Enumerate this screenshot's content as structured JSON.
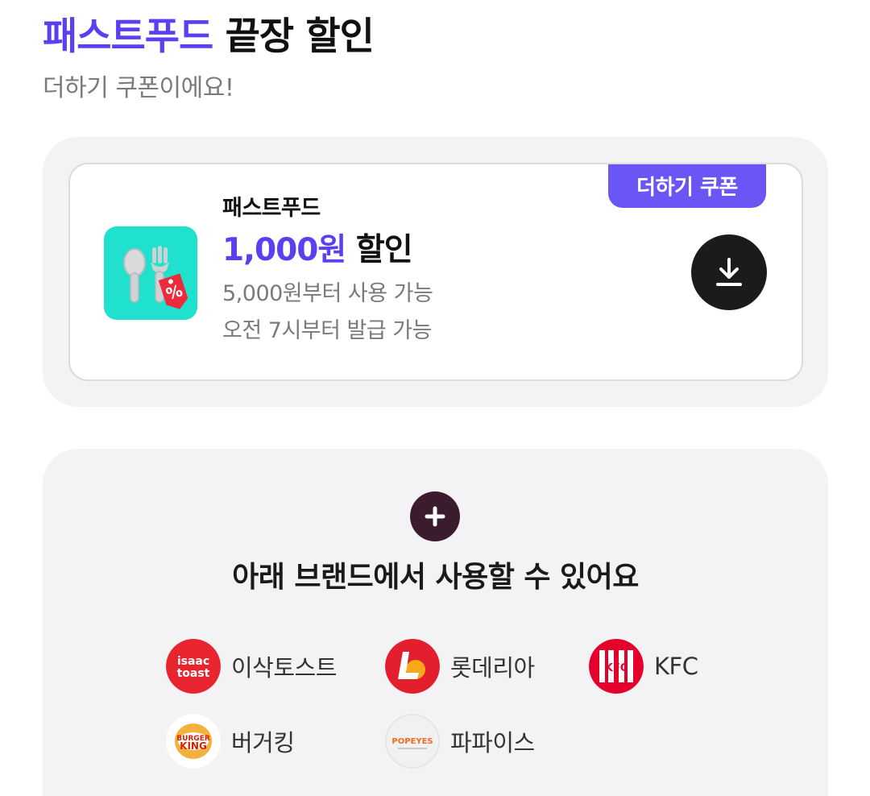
{
  "header": {
    "title_accent": "패스트푸드",
    "title_rest": "끝장 할인",
    "subtitle": "더하기 쿠폰이에요!"
  },
  "coupon": {
    "tag": "더하기 쿠폰",
    "category": "패스트푸드",
    "amount": "1,000원",
    "discount_word": "할인",
    "min_order": "5,000원부터 사용 가능",
    "issue_time": "오전 7시부터 발급 가능",
    "icon": "fork-spoon-discount-icon",
    "action_icon": "download-icon"
  },
  "brands": {
    "title": "아래 브랜드에서 사용할 수 있어요",
    "badge_icon": "plus-icon",
    "items": [
      {
        "name": "이삭토스트",
        "logo_text_1": "isaac",
        "logo_text_2": "toast"
      },
      {
        "name": "롯데리아",
        "logo_text": "L"
      },
      {
        "name": "KFC",
        "logo_text": "KFC"
      },
      {
        "name": "버거킹",
        "logo_text_1": "BURGER",
        "logo_text_2": "KING"
      },
      {
        "name": "파파이스",
        "logo_text": "POPEYES"
      }
    ]
  },
  "colors": {
    "accent": "#5b3ff0",
    "tag": "#6c55f5",
    "mint": "#1fe1cd",
    "panel": "#f3f3f5"
  }
}
